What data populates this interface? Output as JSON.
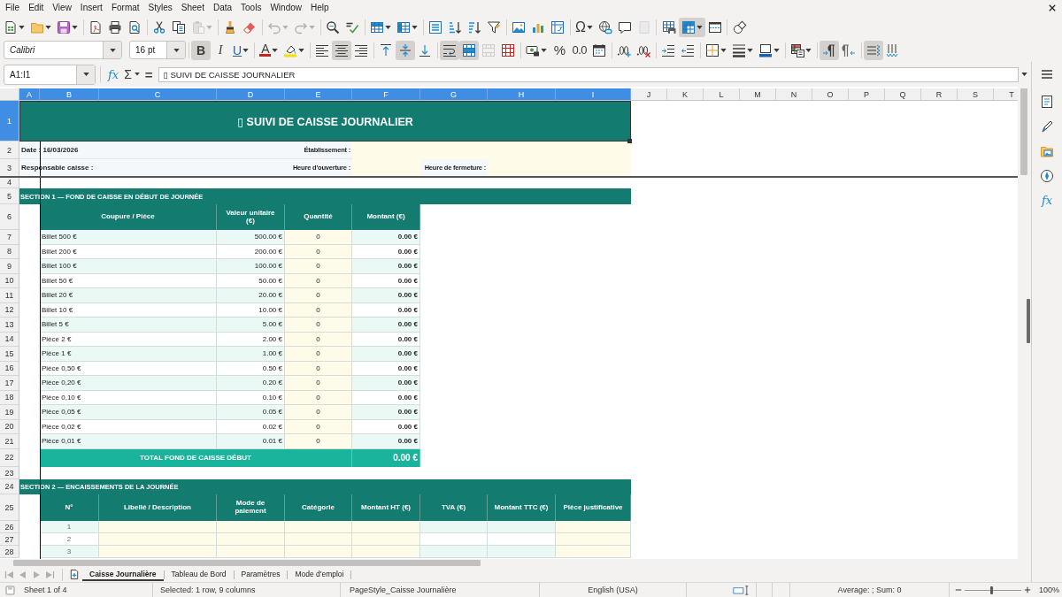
{
  "menu": [
    "File",
    "Edit",
    "View",
    "Insert",
    "Format",
    "Styles",
    "Sheet",
    "Data",
    "Tools",
    "Window",
    "Help"
  ],
  "standard_toolbar": [
    {
      "selected": false,
      "disabled": false
    },
    {
      "selected": false,
      "disabled": false
    },
    {
      "selected": false,
      "disabled": false
    },
    {
      "selected": false,
      "disabled": false
    },
    {
      "selected": false,
      "disabled": false
    },
    {
      "selected": false,
      "disabled": false
    },
    {
      "selected": false,
      "disabled": false
    },
    {
      "selected": false,
      "disabled": false
    },
    {
      "selected": false,
      "disabled": true
    },
    {
      "selected": false,
      "disabled": false
    },
    {
      "selected": false,
      "disabled": false
    },
    {
      "selected": false,
      "disabled": true
    },
    {
      "selected": false,
      "disabled": true
    },
    {
      "selected": false,
      "disabled": false
    },
    {
      "selected": false,
      "disabled": false
    },
    {
      "selected": false,
      "disabled": false
    },
    {
      "selected": false,
      "disabled": false
    },
    {
      "selected": false,
      "disabled": false
    },
    {
      "selected": false,
      "disabled": false
    },
    {
      "selected": false,
      "disabled": false
    },
    {
      "selected": false,
      "disabled": false
    },
    {
      "selected": false,
      "disabled": false
    },
    {
      "selected": false,
      "disabled": false
    },
    {
      "selected": false,
      "disabled": false
    },
    {
      "label": "Ω",
      "selected": false,
      "disabled": false
    },
    {
      "selected": false,
      "disabled": false
    },
    {
      "selected": false,
      "disabled": false
    },
    {
      "selected": false,
      "disabled": true
    },
    {
      "selected": false,
      "disabled": false
    },
    {
      "selected": true,
      "disabled": false
    },
    {
      "selected": false,
      "disabled": false
    },
    {
      "selected": false,
      "disabled": false
    }
  ],
  "formatting_toolbar": {
    "font_name": "Calibri",
    "font_size": "16 pt",
    "buttons": [
      {
        "label": "B",
        "selected": true,
        "disabled": false
      },
      {
        "label": "I",
        "selected": false,
        "disabled": false
      },
      {
        "label": "U",
        "selected": false,
        "disabled": false
      },
      {
        "label": "A",
        "selected": false,
        "disabled": false
      },
      {
        "selected": false,
        "disabled": false
      },
      {
        "selected": false,
        "disabled": false
      },
      {
        "selected": true,
        "disabled": false
      },
      {
        "selected": false,
        "disabled": false
      },
      {
        "selected": false,
        "disabled": false
      },
      {
        "selected": true,
        "disabled": false
      },
      {
        "selected": false,
        "disabled": false
      },
      {
        "selected": true,
        "disabled": false
      },
      {
        "selected": true,
        "disabled": false
      },
      {
        "selected": false,
        "disabled": true
      },
      {
        "selected": false,
        "disabled": false
      },
      {
        "selected": false,
        "disabled": false
      },
      {
        "label": "%",
        "selected": false,
        "disabled": false
      },
      {
        "label": "0.0",
        "selected": false,
        "disabled": false
      },
      {
        "selected": false,
        "disabled": false
      },
      {
        "selected": false,
        "disabled": false
      },
      {
        "selected": false,
        "disabled": false
      },
      {
        "selected": false,
        "disabled": false
      },
      {
        "selected": false,
        "disabled": false
      },
      {
        "selected": false,
        "disabled": false
      },
      {
        "selected": false,
        "disabled": false
      },
      {
        "selected": false,
        "disabled": false
      },
      {
        "selected": false,
        "disabled": false
      },
      {
        "selected": true,
        "disabled": false
      },
      {
        "selected": false,
        "disabled": false
      },
      {
        "selected": true,
        "disabled": false
      },
      {
        "selected": false,
        "disabled": false
      }
    ]
  },
  "formula_bar": {
    "name_box": "A1:I1",
    "buttons": [
      {
        "label": "fx"
      },
      {
        "label": "Σ"
      },
      {
        "label": "="
      }
    ],
    "content": "▯ SUIVI DE CAISSE JOURNALIER"
  },
  "sidebar": {
    "functions": "fx"
  },
  "sheet": {
    "columns": [
      {
        "label": "A",
        "selected": true
      },
      {
        "label": "B",
        "selected": true
      },
      {
        "label": "C",
        "selected": true
      },
      {
        "label": "D",
        "selected": true
      },
      {
        "label": "E",
        "selected": true
      },
      {
        "label": "F",
        "selected": true
      },
      {
        "label": "G",
        "selected": true
      },
      {
        "label": "H",
        "selected": true
      },
      {
        "label": "I",
        "selected": true
      },
      {
        "label": "J",
        "selected": false
      },
      {
        "label": "K",
        "selected": false
      },
      {
        "label": "L",
        "selected": false
      },
      {
        "label": "M",
        "selected": false
      },
      {
        "label": "N",
        "selected": false
      },
      {
        "label": "O",
        "selected": false
      },
      {
        "label": "P",
        "selected": false
      },
      {
        "label": "Q",
        "selected": false
      },
      {
        "label": "R",
        "selected": false
      },
      {
        "label": "S",
        "selected": false
      },
      {
        "label": "T",
        "selected": false
      }
    ],
    "row_headers": [
      {
        "label": "1",
        "selected": true
      },
      {
        "label": "2",
        "selected": false
      },
      {
        "label": "3",
        "selected": false
      },
      {
        "label": "4",
        "selected": false
      },
      {
        "label": "5",
        "selected": false
      },
      {
        "label": "6",
        "selected": false
      },
      {
        "label": "7",
        "selected": false
      },
      {
        "label": "8",
        "selected": false
      },
      {
        "label": "9",
        "selected": false
      },
      {
        "label": "10",
        "selected": false
      },
      {
        "label": "11",
        "selected": false
      },
      {
        "label": "12",
        "selected": false
      },
      {
        "label": "13",
        "selected": false
      },
      {
        "label": "14",
        "selected": false
      },
      {
        "label": "15",
        "selected": false
      },
      {
        "label": "16",
        "selected": false
      },
      {
        "label": "17",
        "selected": false
      },
      {
        "label": "18",
        "selected": false
      },
      {
        "label": "19",
        "selected": false
      },
      {
        "label": "20",
        "selected": false
      },
      {
        "label": "21",
        "selected": false
      },
      {
        "label": "22",
        "selected": false
      },
      {
        "label": "23",
        "selected": false
      },
      {
        "label": "24",
        "selected": false
      },
      {
        "label": "25",
        "selected": false
      },
      {
        "label": "26",
        "selected": false
      },
      {
        "label": "27",
        "selected": false
      },
      {
        "label": "28",
        "selected": false
      }
    ],
    "title": "▯ SUIVI DE CAISSE JOURNALIER",
    "info": {
      "date": "Date : 16/03/2026",
      "establishment": "Établissement :",
      "cashier": "Responsable caisse :",
      "opening_time": "Heure d'ouverture :",
      "closing_time": "Heure de fermeture :"
    },
    "section_1": {
      "title": "SECTION 1 — FOND DE CAISSE EN DÉBUT DE JOURNÉE",
      "columns": [
        "Coupure / Pièce",
        "Valeur unitaire (€)",
        "Quantité",
        "Montant (€)"
      ],
      "rows": [
        {
          "denomination": "Billet 500 €",
          "unit_value": "500.00 €",
          "quantity": "0",
          "amount": "0.00 €"
        },
        {
          "denomination": "Billet 200 €",
          "unit_value": "200.00 €",
          "quantity": "0",
          "amount": "0.00 €"
        },
        {
          "denomination": "Billet 100 €",
          "unit_value": "100.00 €",
          "quantity": "0",
          "amount": "0.00 €"
        },
        {
          "denomination": "Billet 50 €",
          "unit_value": "50.00 €",
          "quantity": "0",
          "amount": "0.00 €"
        },
        {
          "denomination": "Billet 20 €",
          "unit_value": "20.00 €",
          "quantity": "0",
          "amount": "0.00 €"
        },
        {
          "denomination": "Billet 10 €",
          "unit_value": "10.00 €",
          "quantity": "0",
          "amount": "0.00 €"
        },
        {
          "denomination": "Billet 5 €",
          "unit_value": "5.00 €",
          "quantity": "0",
          "amount": "0.00 €"
        },
        {
          "denomination": "Pièce 2 €",
          "unit_value": "2.00 €",
          "quantity": "0",
          "amount": "0.00 €"
        },
        {
          "denomination": "Pièce 1 €",
          "unit_value": "1.00 €",
          "quantity": "0",
          "amount": "0.00 €"
        },
        {
          "denomination": "Pièce 0,50 €",
          "unit_value": "0.50 €",
          "quantity": "0",
          "amount": "0.00 €"
        },
        {
          "denomination": "Pièce 0,20 €",
          "unit_value": "0.20 €",
          "quantity": "0",
          "amount": "0.00 €"
        },
        {
          "denomination": "Pièce 0,10 €",
          "unit_value": "0.10 €",
          "quantity": "0",
          "amount": "0.00 €"
        },
        {
          "denomination": "Pièce 0,05 €",
          "unit_value": "0.05 €",
          "quantity": "0",
          "amount": "0.00 €"
        },
        {
          "denomination": "Pièce 0,02 €",
          "unit_value": "0.02 €",
          "quantity": "0",
          "amount": "0.00 €"
        },
        {
          "denomination": "Pièce 0,01 €",
          "unit_value": "0.01 €",
          "quantity": "0",
          "amount": "0.00 €"
        }
      ],
      "total_label": "TOTAL FOND DE CAISSE DÉBUT",
      "total": "0.00 €"
    },
    "section_2": {
      "title": "SECTION 2 — ENCAISSEMENTS DE LA JOURNÉE",
      "columns": [
        "N°",
        "Libellé / Description",
        "Mode de paiement",
        "Catégorie",
        "Montant HT (€)",
        "TVA (€)",
        "Montant TTC (€)",
        "Pièce justificative"
      ],
      "rows": [
        {
          "number": "1"
        },
        {
          "number": "2"
        },
        {
          "number": "3"
        }
      ]
    }
  },
  "sheet_navigation": [
    {
      "disabled": true
    },
    {
      "disabled": true
    },
    {
      "disabled": true
    },
    {
      "disabled": true
    }
  ],
  "sheet_tabs": [
    {
      "label": "Caisse Journalière",
      "selected": true
    },
    {
      "label": "Tableau de Bord",
      "selected": false
    },
    {
      "label": "Paramètres",
      "selected": false
    },
    {
      "label": "Mode d'emploi",
      "selected": false
    }
  ],
  "status_bar": {
    "sheet": "Sheet 1 of 4",
    "selection": "Selected: 1 row, 9 columns",
    "page_style": "PageStyle_Caisse Journalière",
    "language": "English (USA)",
    "summary": "Average: ; Sum: 0",
    "zoom": {
      "level": 0.48
    },
    "zoom_label": "100%"
  }
}
